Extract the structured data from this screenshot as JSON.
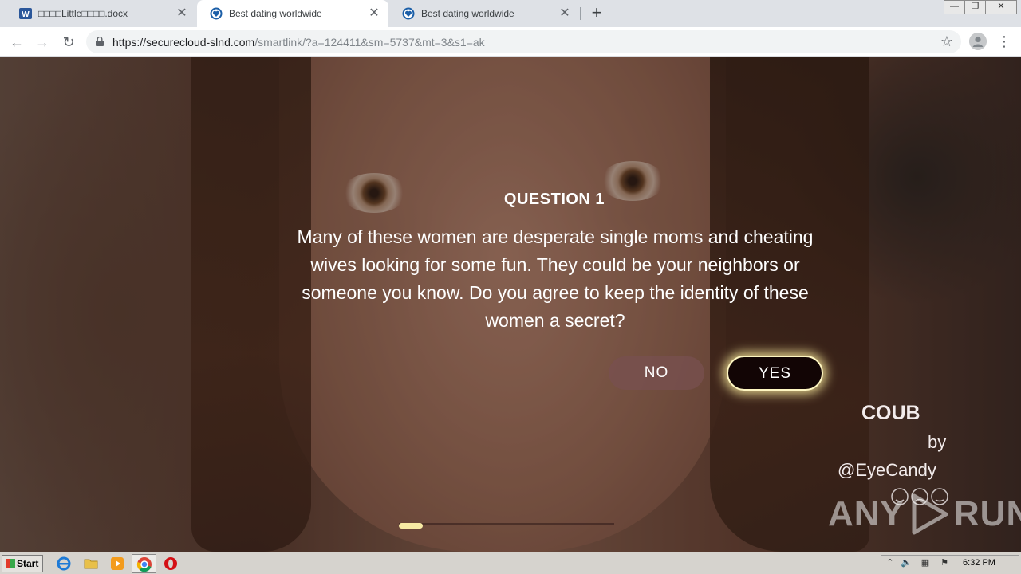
{
  "browser": {
    "tabs": [
      {
        "title": "□□□□Little□□□□.docx",
        "icon": "word-doc-icon"
      },
      {
        "title": "Best dating worldwide",
        "icon": "heart-shield-icon",
        "active": true
      },
      {
        "title": "Best dating worldwide",
        "icon": "heart-shield-icon"
      }
    ],
    "new_tab_symbol": "+",
    "close_symbol": "✕",
    "window_controls": {
      "minimize": "—",
      "restore": "❐",
      "close": "✕"
    },
    "address": {
      "host": "https://securecloud-slnd.com",
      "path": "/smartlink/?a=124411&sm=5737&mt=3&s1=ak"
    },
    "nav": {
      "back": "←",
      "forward": "→",
      "reload": "↻",
      "bookmark": "☆",
      "menu": "⋮"
    }
  },
  "page": {
    "question_title": "QUESTION 1",
    "question_text": "Many of these women are desperate single moms and cheating wives looking for some fun. They could be your neighbors or someone you know. Do you agree to keep the identity of these women a secret?",
    "no_label": "NO",
    "yes_label": "YES",
    "credit": {
      "brand": "COUB",
      "by": "by",
      "author": "@EyeCandy"
    },
    "progress": 0.11,
    "watermark": {
      "left": "ANY",
      "right": "RUN"
    }
  },
  "taskbar": {
    "start_label": "Start",
    "clock": "6:32 PM",
    "icons": [
      "internet-explorer-icon",
      "folder-icon",
      "media-player-icon",
      "chrome-icon",
      "opera-icon"
    ]
  },
  "colors": {
    "yes_button": "#120505",
    "yes_glow": "#fff7c2",
    "progress_fill": "#f7eaa4"
  }
}
